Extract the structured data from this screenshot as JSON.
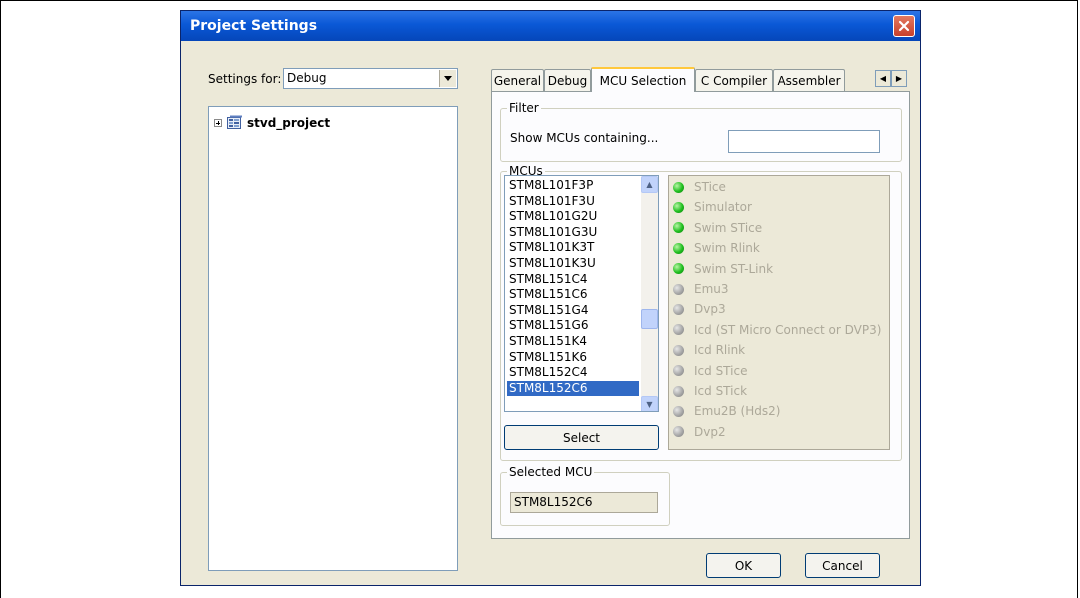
{
  "window": {
    "title": "Project Settings"
  },
  "settings_for": {
    "label": "Settings for:",
    "value": "Debug"
  },
  "tree": {
    "project": "stvd_project"
  },
  "tabs": [
    "General",
    "Debug",
    "MCU Selection",
    "C Compiler",
    "Assembler"
  ],
  "active_tab": "MCU Selection",
  "filter": {
    "group_label": "Filter",
    "label": "Show MCUs containing...",
    "value": ""
  },
  "mcus": {
    "group_label": "MCUs",
    "items": [
      "STM8L101F3P",
      "STM8L101F3U",
      "STM8L101G2U",
      "STM8L101G3U",
      "STM8L101K3T",
      "STM8L101K3U",
      "STM8L151C4",
      "STM8L151C6",
      "STM8L151G4",
      "STM8L151G6",
      "STM8L151K4",
      "STM8L151K6",
      "STM8L152C4",
      "STM8L152C6"
    ],
    "selected": "STM8L152C6",
    "select_button": "Select"
  },
  "debuggers": [
    {
      "name": "STice",
      "available": true
    },
    {
      "name": "Simulator",
      "available": true
    },
    {
      "name": "Swim STice",
      "available": true
    },
    {
      "name": "Swim Rlink",
      "available": true
    },
    {
      "name": "Swim ST-Link",
      "available": true
    },
    {
      "name": "Emu3",
      "available": false
    },
    {
      "name": "Dvp3",
      "available": false
    },
    {
      "name": "Icd (ST Micro Connect or DVP3)",
      "available": false
    },
    {
      "name": "Icd Rlink",
      "available": false
    },
    {
      "name": "Icd STice",
      "available": false
    },
    {
      "name": "Icd STick",
      "available": false
    },
    {
      "name": "Emu2B (Hds2)",
      "available": false
    },
    {
      "name": "Dvp2",
      "available": false
    }
  ],
  "selected_mcu": {
    "group_label": "Selected MCU",
    "value": "STM8L152C6"
  },
  "buttons": {
    "ok": "OK",
    "cancel": "Cancel"
  },
  "colors": {
    "title_bar": "#0a58d6",
    "selection": "#316ac5",
    "led_on": "#1fbf1f",
    "led_off": "#a8a8a8"
  }
}
